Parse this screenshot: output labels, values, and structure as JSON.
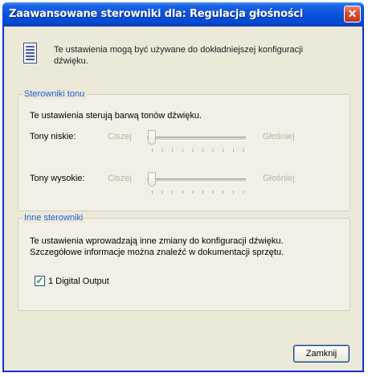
{
  "window": {
    "title": "Zaawansowane sterowniki dla: Regulacja głośności"
  },
  "icons": {
    "close": "close-icon",
    "info": "settings-sheet-icon",
    "check": "checkmark-icon"
  },
  "close_glyph": "✕",
  "info_text": "Te ustawienia mogą być używane do dokładniejszej konfiguracji dźwięku.",
  "tone": {
    "group_label": "Sterowniki tonu",
    "description": "Te ustawienia sterują barwą tonów dźwięku.",
    "bass": {
      "label": "Tony niskie:",
      "min_label": "Ciszej",
      "max_label": "Głośniej",
      "value": 0
    },
    "treble": {
      "label": "Tony wysokie:",
      "min_label": "Ciszej",
      "max_label": "Głośniej",
      "value": 0
    }
  },
  "other": {
    "group_label": "Inne sterowniki",
    "description_line1": "Te ustawienia wprowadzają inne zmiany do konfiguracji dźwięku.",
    "description_line2": "Szczegółowe informacje można znaleźć w dokumentacji sprzętu.",
    "checkbox_label": "1  Digital Output",
    "checkbox_checked": true
  },
  "buttons": {
    "close_label": "Zamknij"
  },
  "colors": {
    "title_bar": "#0a52d8",
    "group_label": "#1f5fdb",
    "close_button": "#d6462c"
  }
}
